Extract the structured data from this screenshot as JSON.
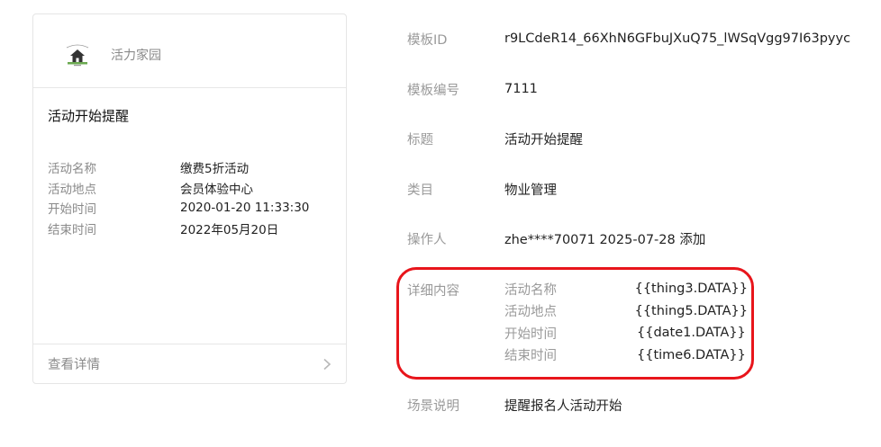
{
  "preview": {
    "brand_name": "活力家园",
    "title": "活动开始提醒",
    "fields": [
      {
        "key": "活动名称",
        "value": "缴费5折活动"
      },
      {
        "key": "活动地点",
        "value": "会员体验中心"
      },
      {
        "key": "开始时间",
        "value": "2020-01-20 11:33:30"
      },
      {
        "key": "结束时间",
        "value": "2022年05月20日"
      }
    ],
    "footer_label": "查看详情",
    "footer_icon": "chevron-right-icon"
  },
  "details": {
    "template_id_label": "模板ID",
    "template_id": "r9LCdeR14_66XhN6GFbuJXuQ75_lWSqVgg97I63pyyc",
    "template_no_label": "模板编号",
    "template_no": "7111",
    "title_label": "标题",
    "title": "活动开始提醒",
    "category_label": "类目",
    "category": "物业管理",
    "operator_label": "操作人",
    "operator": "zhe****70071 2025-07-28 添加",
    "content_label": "详细内容",
    "content_fields": [
      {
        "key": "活动名称",
        "value": "{{thing3.DATA}}"
      },
      {
        "key": "活动地点",
        "value": "{{thing5.DATA}}"
      },
      {
        "key": "开始时间",
        "value": "{{date1.DATA}}"
      },
      {
        "key": "结束时间",
        "value": "{{time6.DATA}}"
      }
    ],
    "scene_label": "场景说明",
    "scene": "提醒报名人活动开始"
  },
  "colors": {
    "highlight": "#e8151b",
    "logo_green": "#6aa84f"
  }
}
